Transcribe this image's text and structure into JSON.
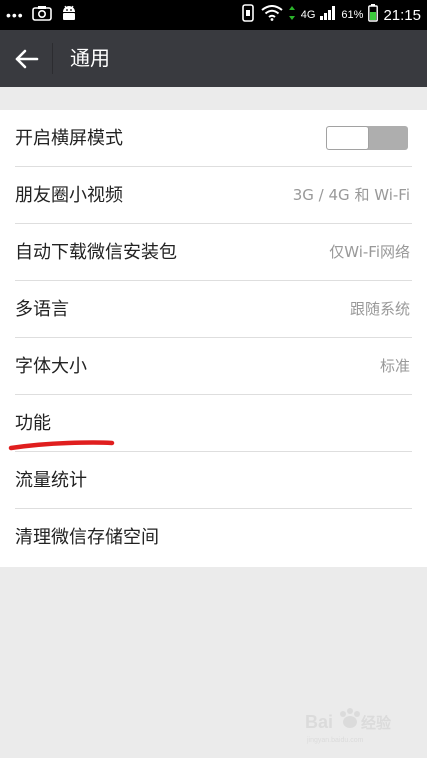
{
  "status_bar": {
    "dots": "•••",
    "network": "4G",
    "battery": "61%",
    "time": "21:15"
  },
  "header": {
    "title": "通用"
  },
  "settings": [
    {
      "label": "开启横屏模式",
      "value": "",
      "control": "toggle",
      "toggle_on": false
    },
    {
      "label": "朋友圈小视频",
      "value": "3G / 4G 和 Wi-Fi"
    },
    {
      "label": "自动下载微信安装包",
      "value": "仅Wi-Fi网络"
    },
    {
      "label": "多语言",
      "value": "跟随系统"
    },
    {
      "label": "字体大小",
      "value": "标准"
    },
    {
      "label": "功能",
      "value": ""
    },
    {
      "label": "流量统计",
      "value": ""
    },
    {
      "label": "清理微信存储空间",
      "value": ""
    }
  ],
  "colors": {
    "app_bar": "#393a3f",
    "background": "#ebebeb",
    "annotation_red": "#e01e1e"
  },
  "watermark": "Baidu 经验"
}
